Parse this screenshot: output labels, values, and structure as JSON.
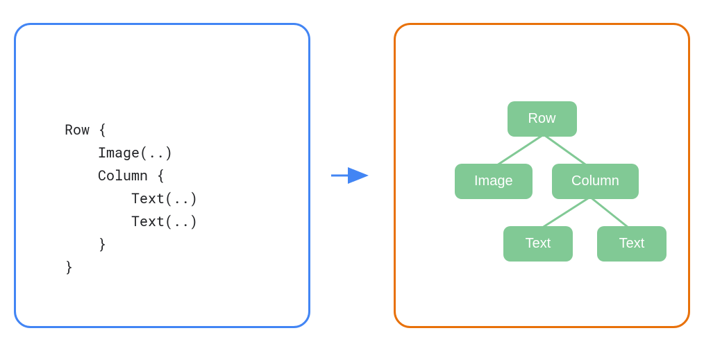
{
  "code": {
    "line1": "Row {",
    "line2": "    Image(..)",
    "line3": "    Column {",
    "line4": "        Text(..)",
    "line5": "        Text(..)",
    "line6": "    }",
    "line7": "}"
  },
  "tree": {
    "root": "Row",
    "child1": "Image",
    "child2": "Column",
    "grandchild1": "Text",
    "grandchild2": "Text"
  },
  "colors": {
    "blue_border": "#4285f4",
    "orange_border": "#e8710a",
    "node_green": "#81c995",
    "edge_green": "#81c995",
    "arrow_blue": "#4285f4"
  }
}
